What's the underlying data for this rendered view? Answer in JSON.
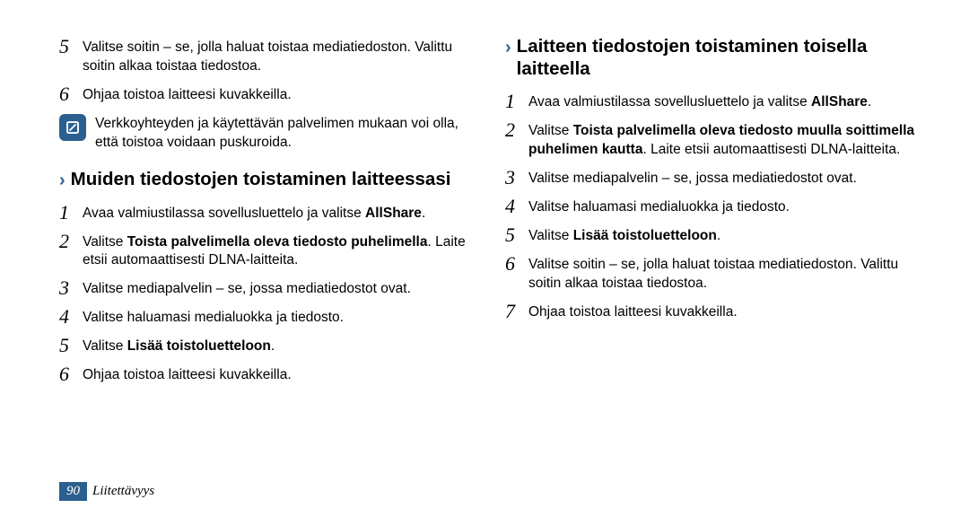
{
  "left": {
    "step5": "Valitse soitin – se, jolla haluat toistaa mediatiedoston. Valittu soitin alkaa toistaa tiedostoa.",
    "step6": "Ohjaa toistoa laitteesi kuvakkeilla.",
    "note": "Verkkoyhteyden ja käytettävän palvelimen mukaan voi olla, että toistoa voidaan puskuroida.",
    "heading": "Muiden tiedostojen toistaminen laitteessasi",
    "b1_pre": "Avaa valmiustilassa sovellusluettelo ja valitse ",
    "b1_bold": "AllShare",
    "b1_post": ".",
    "b2_pre": "Valitse ",
    "b2_bold": "Toista palvelimella oleva tiedosto puhelimella",
    "b2_post": ". Laite etsii automaattisesti DLNA-laitteita.",
    "b3": "Valitse mediapalvelin – se, jossa mediatiedostot ovat.",
    "b4": "Valitse haluamasi medialuokka ja tiedosto.",
    "b5_pre": "Valitse ",
    "b5_bold": "Lisää toistoluetteloon",
    "b5_post": ".",
    "b6": "Ohjaa toistoa laitteesi kuvakkeilla."
  },
  "right": {
    "heading": "Laitteen tiedostojen toistaminen toisella laitteella",
    "r1_pre": "Avaa valmiustilassa sovellusluettelo ja valitse ",
    "r1_bold": "AllShare",
    "r1_post": ".",
    "r2_pre": "Valitse ",
    "r2_bold": "Toista palvelimella oleva tiedosto muulla soittimella puhelimen kautta",
    "r2_post": ". Laite etsii automaattisesti DLNA-laitteita.",
    "r3": "Valitse mediapalvelin – se, jossa mediatiedostot ovat.",
    "r4": "Valitse haluamasi medialuokka ja tiedosto.",
    "r5_pre": "Valitse ",
    "r5_bold": "Lisää toistoluetteloon",
    "r5_post": ".",
    "r6": "Valitse soitin – se, jolla haluat toistaa mediatiedoston. Valittu soitin alkaa toistaa tiedostoa.",
    "r7": "Ohjaa toistoa laitteesi kuvakkeilla."
  },
  "footer": {
    "page": "90",
    "section": "Liitettävyys"
  },
  "nums": {
    "n1": "1",
    "n2": "2",
    "n3": "3",
    "n4": "4",
    "n5": "5",
    "n6": "6",
    "n7": "7"
  }
}
